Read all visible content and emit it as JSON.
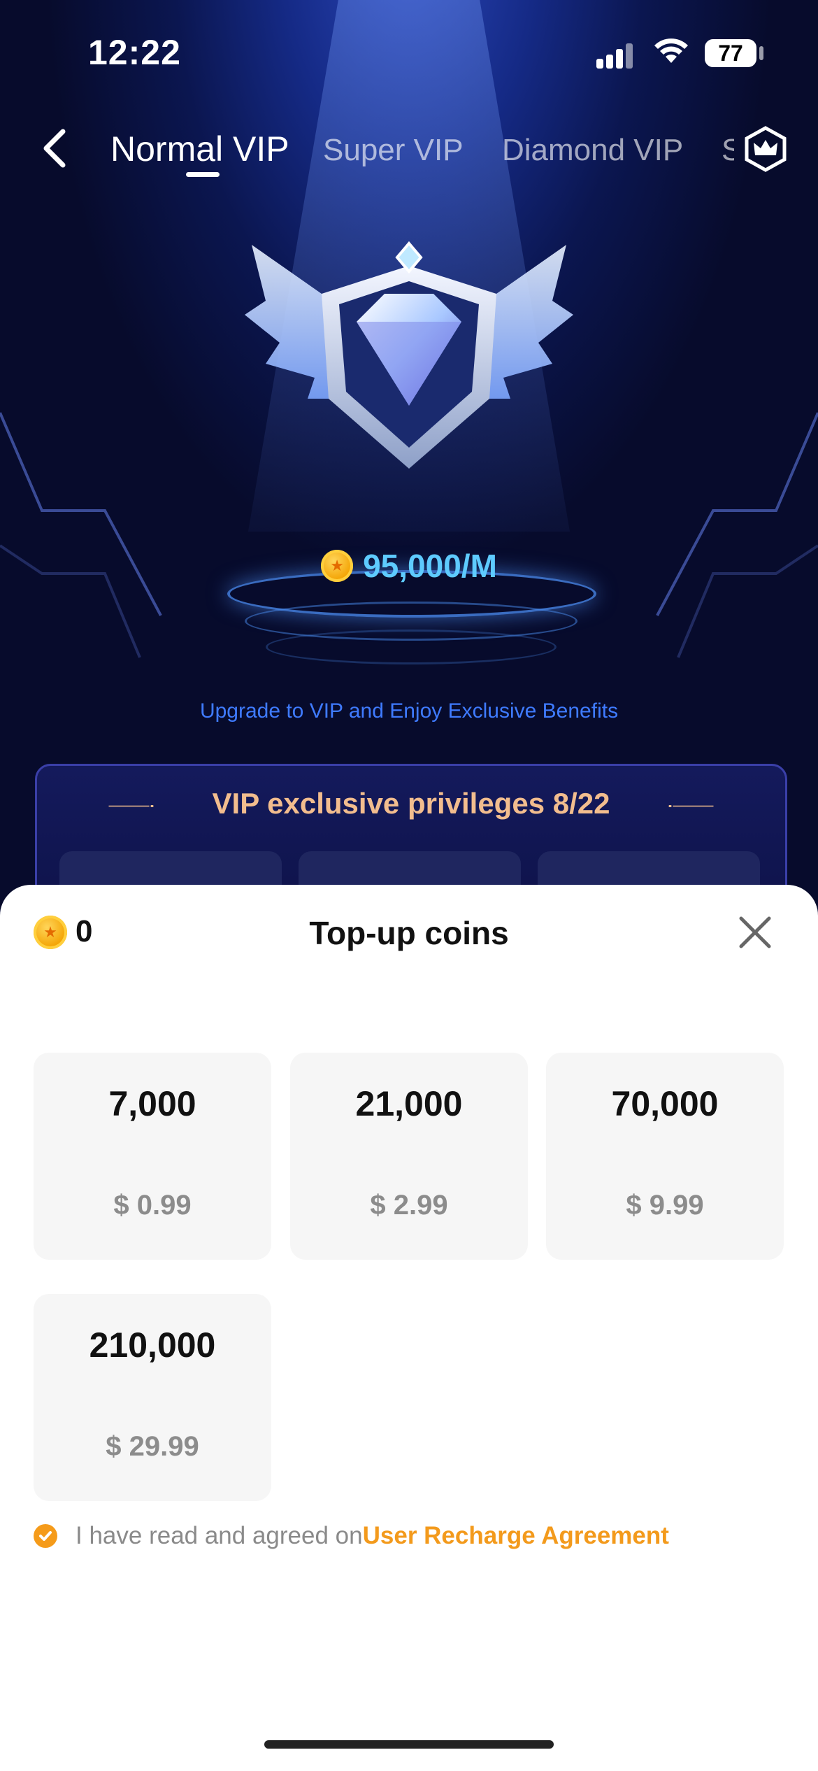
{
  "status_bar": {
    "time": "12:22",
    "battery": "77"
  },
  "tabs": [
    "Normal VIP",
    "Super VIP",
    "Diamond VIP",
    "S"
  ],
  "vip": {
    "price": "95,000/M",
    "upgrade_text": "Upgrade to VIP and Enjoy Exclusive Benefits",
    "privileges_title": "VIP exclusive privileges 8/22"
  },
  "sheet": {
    "balance": "0",
    "title": "Top-up coins",
    "packages": [
      {
        "coins": "7,000",
        "price": "$ 0.99"
      },
      {
        "coins": "21,000",
        "price": "$ 2.99"
      },
      {
        "coins": "70,000",
        "price": "$ 9.99"
      },
      {
        "coins": "210,000",
        "price": "$ 29.99"
      }
    ],
    "agreement_text": "I have read and agreed on",
    "agreement_link": "User Recharge Agreement"
  },
  "colors": {
    "accent_orange": "#f39a1c",
    "price_blue": "#5ecbff",
    "privilege_gold": "#f2bd8e",
    "upgrade_blue": "#3f7bff"
  },
  "icons": [
    "back-chevron-icon",
    "crown-icon",
    "diamond-emblem-icon",
    "coin-icon",
    "close-icon",
    "check-icon",
    "wifi-icon",
    "signal-icon",
    "battery-icon"
  ]
}
